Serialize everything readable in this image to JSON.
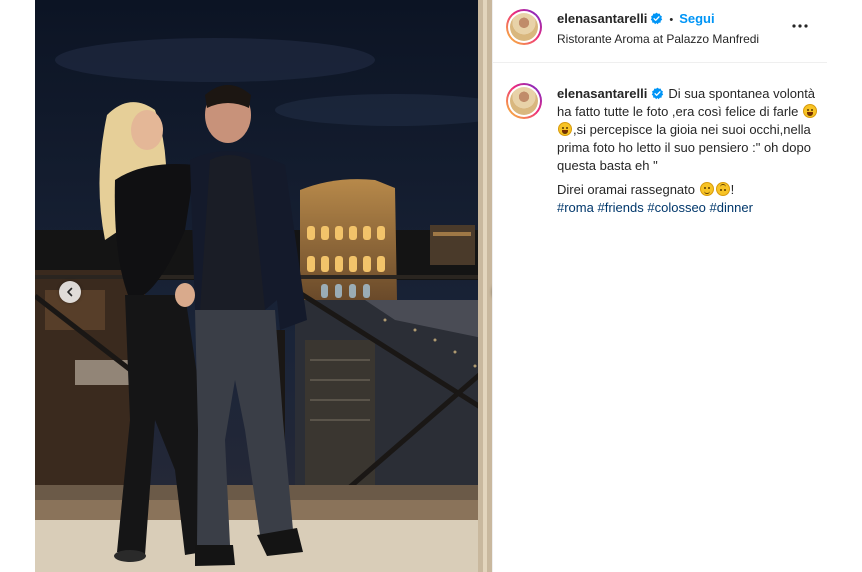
{
  "post": {
    "username": "elenasantarelli",
    "follow_label": "Segui",
    "separator": "•",
    "location": "Ristorante Aroma at Palazzo Manfredi",
    "more_icon": "more-horizontal-icon"
  },
  "caption": {
    "username": "elenasantarelli",
    "text_1a": "Di sua spontanea volontà ha fatto tutte le foto ,era così felice di farle",
    "text_1b": ",si percepisce la gioia nei suoi occhi,nella prima foto ho letto il suo pensiero :\" oh dopo questa basta eh \"",
    "text_2": "Direi oramai rassegnato",
    "text_2_end": "!",
    "hashtags": [
      "#roma",
      "#friends",
      "#colosseo",
      "#dinner"
    ]
  },
  "media": {
    "prev_icon": "chevron-left-icon",
    "next_icon": "chevron-right-icon"
  },
  "colors": {
    "accent_blue": "#0095f6",
    "hashtag": "#00376b",
    "text": "#262626",
    "border": "#efefef"
  }
}
